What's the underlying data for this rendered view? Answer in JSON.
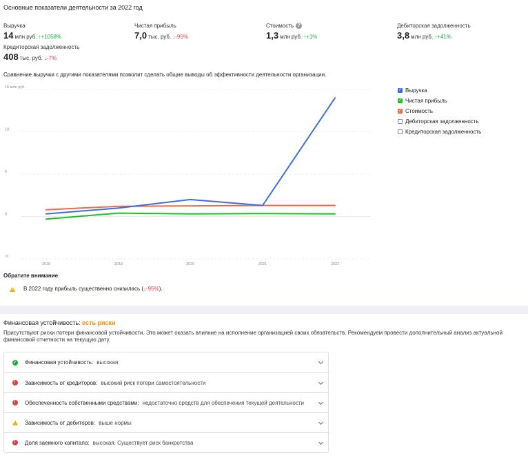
{
  "header": {
    "title": "Основные показатели деятельности за 2022 год"
  },
  "kpis": [
    {
      "label": "Выручка",
      "value": "14",
      "unit": "млн руб.",
      "change": "↑+1058%",
      "direction": "up"
    },
    {
      "label": "Чистая прибыль",
      "value": "7,0",
      "unit": "тыс. руб.",
      "change": "↓-95%",
      "direction": "down"
    },
    {
      "label": "Стоимость",
      "value": "1,3",
      "unit": "млн руб.",
      "change": "↑+1%",
      "direction": "up",
      "help": "?"
    },
    {
      "label": "Дебиторская задолженность",
      "value": "3,8",
      "unit": "млн руб.",
      "change": "↑+41%",
      "direction": "up"
    },
    {
      "label": "Кредиторская задолженность",
      "value": "408",
      "unit": "тыс. руб.",
      "change": "↓-7%",
      "direction": "down"
    }
  ],
  "comparison_text": "Сравнение выручки с другими показателями позволит сделать общие выводы об эффективности деятельности организации.",
  "legend": [
    {
      "label": "Выручка",
      "checked": true,
      "color": "#3b6fe0"
    },
    {
      "label": "Чистая прибыль",
      "checked": true,
      "color": "#1ec21e"
    },
    {
      "label": "Стоимость",
      "checked": true,
      "color": "#f06a4a"
    },
    {
      "label": "Дебиторская задолженность",
      "checked": false,
      "color": "#888888"
    },
    {
      "label": "Кредиторская задолженность",
      "checked": false,
      "color": "#888888"
    }
  ],
  "chart_data": {
    "type": "line",
    "ylabel": "15 млн руб.",
    "x": [
      "2018",
      "2019",
      "2020",
      "2021",
      "2022"
    ],
    "y_ticks": [
      "10",
      "5",
      "0",
      "-5"
    ],
    "ylim": [
      -5,
      15
    ],
    "grid": true,
    "series": [
      {
        "name": "Выручка",
        "color": "#3b6fe0",
        "values": [
          0.3,
          1.0,
          2.0,
          1.3,
          14.0
        ]
      },
      {
        "name": "Чистая прибыль",
        "color": "#1ec21e",
        "values": [
          -0.3,
          0.4,
          0.3,
          0.35,
          0.3
        ]
      },
      {
        "name": "Стоимость",
        "color": "#f06a4a",
        "values": [
          0.8,
          1.2,
          1.25,
          1.3,
          1.3
        ]
      }
    ]
  },
  "notice": {
    "title": "Обратите внимание",
    "text_before": "В 2022 году прибыль существенно снизилась (",
    "text_highlight": "↓-95%",
    "text_after": ")."
  },
  "financial": {
    "title": "Финансовая устойчивость:",
    "risk": "есть риски",
    "description": "Присутствуют риски потери финансовой устойчивости. Это может оказать влияние на исполнение организацией своих обязательств. Рекомендуем провести дополнительный анализ актуальной финансовой отчетности на текущую дату.",
    "items": [
      {
        "key": "Финансовая устойчивость:",
        "value": "высокая",
        "status": "ok",
        "icon_color": "#1aaa3a",
        "icon": "check-icon"
      },
      {
        "key": "Зависимость от кредиторов:",
        "value": "высокий риск потери самостоятельности",
        "status": "danger",
        "icon_color": "#e23c3c",
        "icon": "alert-icon"
      },
      {
        "key": "Обеспеченность собственными средствами:",
        "value": "недостаточно средств для обеспечения текущей деятельности",
        "status": "danger",
        "icon_color": "#e23c3c",
        "icon": "alert-icon"
      },
      {
        "key": "Зависимость от дебиторов:",
        "value": "выше нормы",
        "status": "warning",
        "icon_color": "#f2b200",
        "icon": "warning-icon"
      },
      {
        "key": "Доля заемного капитала:",
        "value": "высокая. Существует риск банкротства",
        "status": "danger",
        "icon_color": "#e23c3c",
        "icon": "alert-icon"
      }
    ]
  }
}
